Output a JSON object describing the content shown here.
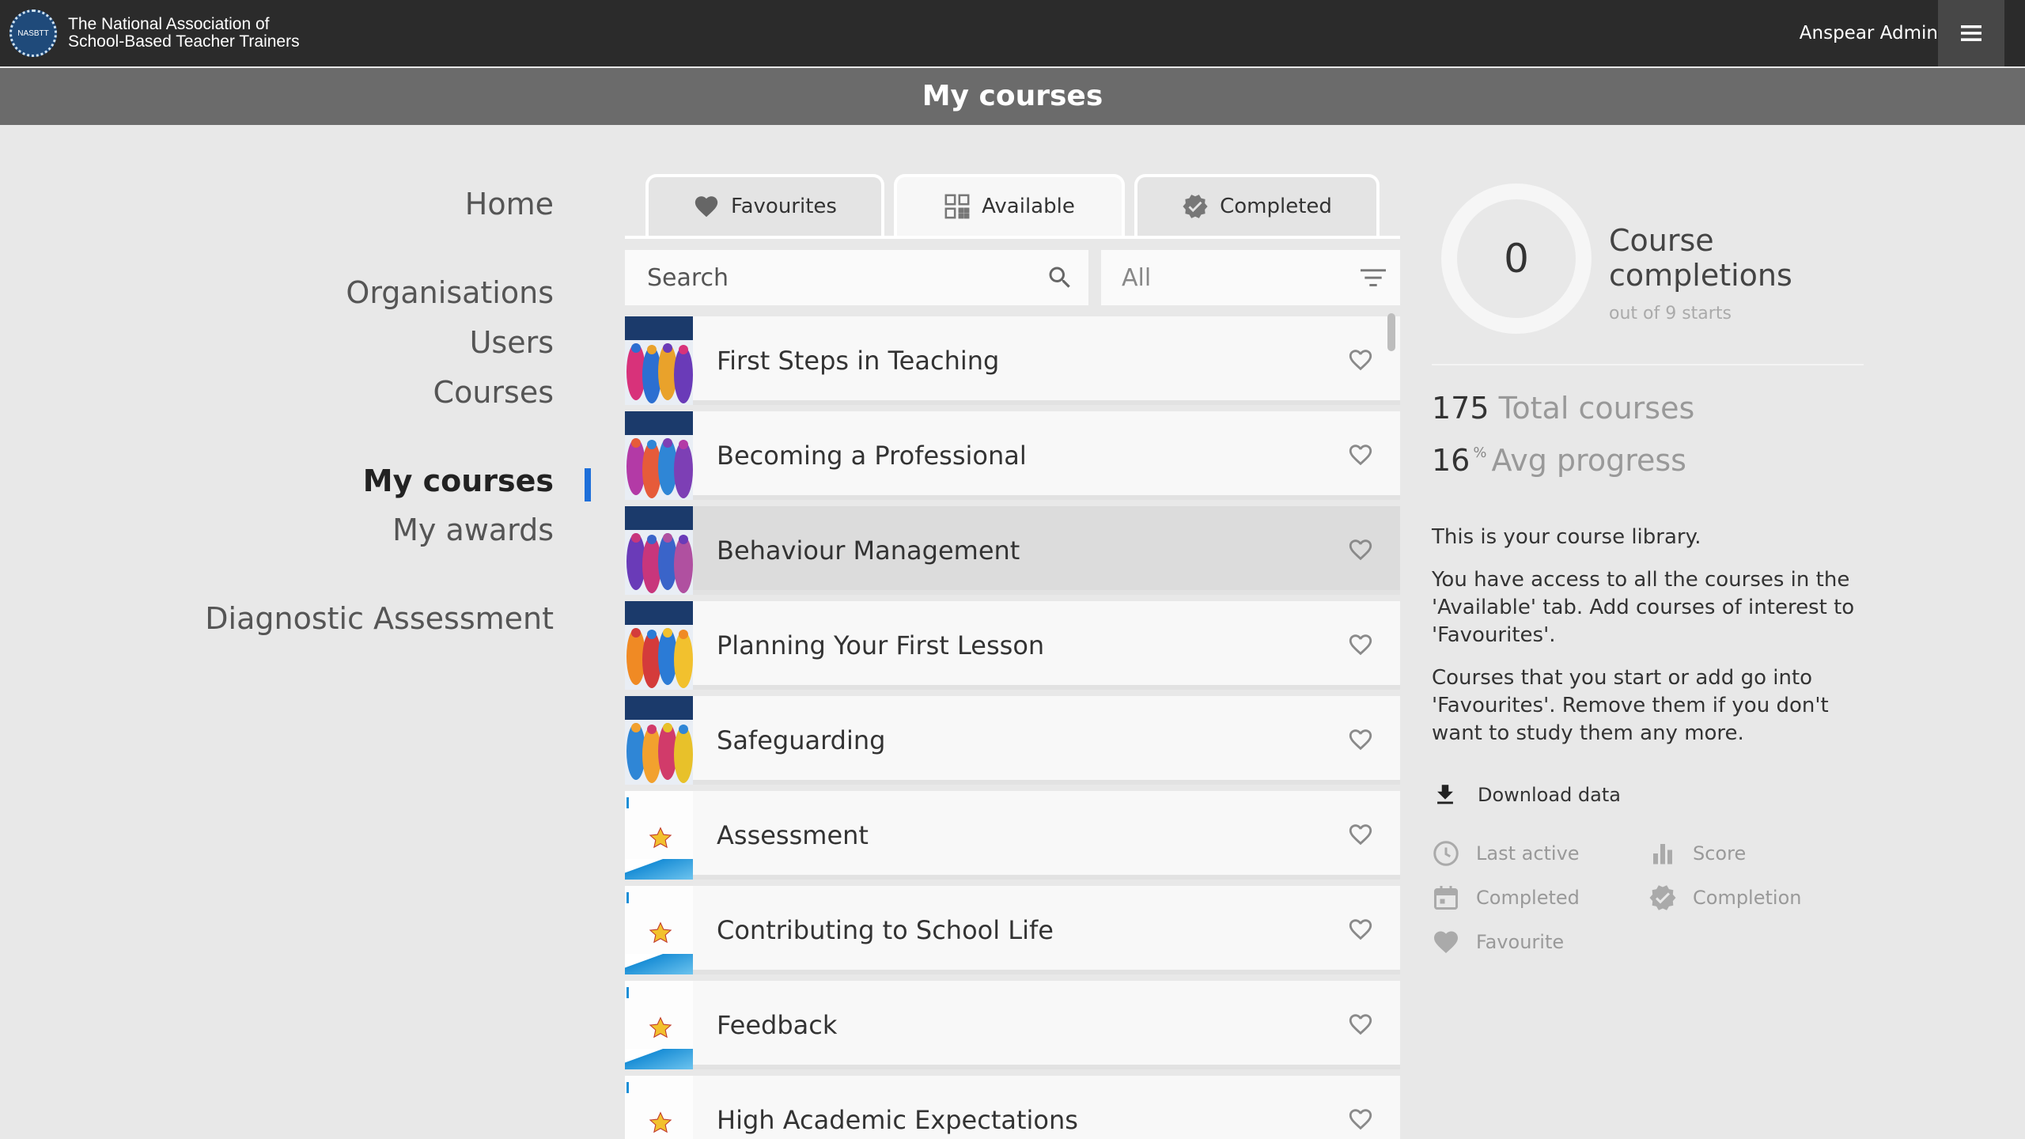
{
  "header": {
    "logo_text": "NASBTT",
    "org_line1": "The National Association of",
    "org_line2": "School-Based Teacher Trainers",
    "user_name": "Anspear Admin",
    "menu_icon": "hamburger-menu-icon"
  },
  "page_title": "My courses",
  "nav": {
    "home": "Home",
    "organisations": "Organisations",
    "users": "Users",
    "courses": "Courses",
    "my_courses": "My courses",
    "my_awards": "My awards",
    "diagnostic": "Diagnostic Assessment"
  },
  "tabs": {
    "favourites": "Favourites",
    "available": "Available",
    "completed": "Completed",
    "active": "Available"
  },
  "search": {
    "placeholder": "Search",
    "icon": "search-icon"
  },
  "filter": {
    "value": "All",
    "icon": "filter-icon"
  },
  "courses": [
    {
      "title": "First Steps in Teaching",
      "thumb_caption": "First Steps in Teaching"
    },
    {
      "title": "Becoming a Professional",
      "thumb_caption": "Becoming a Professional"
    },
    {
      "title": "Behaviour Management",
      "thumb_caption": "Behaviour Management"
    },
    {
      "title": "Planning Your First Lesson",
      "thumb_caption": "Planning Your First Lesson"
    },
    {
      "title": "Safeguarding",
      "thumb_caption": "Safeguarding"
    },
    {
      "title": "Assessment",
      "thumb_caption": "Assessment"
    },
    {
      "title": "Contributing to School Life",
      "thumb_caption": "Contributing to School Life"
    },
    {
      "title": "Feedback",
      "thumb_caption": "Feedback"
    },
    {
      "title": "High Academic Expectations",
      "thumb_caption": "High Academic Expectations"
    }
  ],
  "summary": {
    "completions": "0",
    "completions_label_1": "Course",
    "completions_label_2": "completions",
    "completions_sub": "out of 9 starts",
    "total_courses": "175",
    "total_courses_label": "Total courses",
    "avg_progress": "16",
    "avg_progress_unit": "%",
    "avg_progress_label": "Avg progress"
  },
  "info": {
    "p1": "This is your course library.",
    "p2": "You have access to all the courses in the 'Available' tab. Add courses of interest to 'Favourites'.",
    "p3": "Courses that you start or add go into 'Favourites'. Remove them if you don't want to study them any more."
  },
  "download_label": "Download data",
  "legend": {
    "last_active": "Last active",
    "score": "Score",
    "completed": "Completed",
    "completion": "Completion",
    "favourite": "Favourite"
  },
  "colors": {
    "topbar": "#2b2b2b",
    "titlebar": "#6b6b6b",
    "background": "#e8e8e8",
    "accent": "#1e6fd9"
  }
}
